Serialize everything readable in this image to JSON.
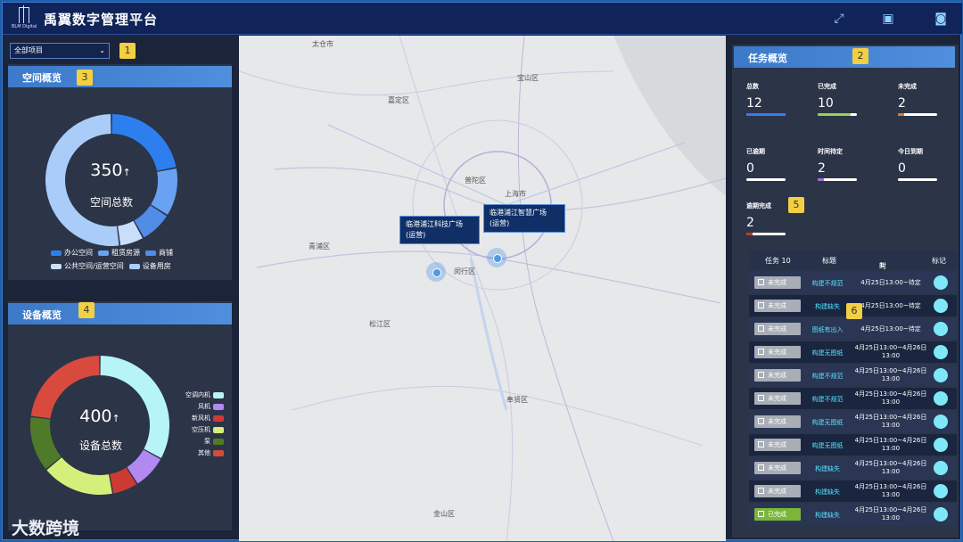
{
  "header": {
    "title": "禹翼数字管理平台",
    "brand": "BLM Digital"
  },
  "project_select": {
    "value": "全部项目"
  },
  "badges": [
    "1",
    "2",
    "3",
    "4",
    "5",
    "6"
  ],
  "space": {
    "title": "空间概览",
    "total": "350",
    "arrow": "↑",
    "total_label": "空间总数",
    "legend": [
      {
        "label": "办公空间",
        "color": "#2d7ff0"
      },
      {
        "label": "租赁房源",
        "color": "#6aa2f3"
      },
      {
        "label": "商铺",
        "color": "#4f8de6"
      },
      {
        "label": "公共空间/运营空间",
        "color": "#c8defa"
      },
      {
        "label": "设备用房",
        "color": "#a9cdf8"
      }
    ]
  },
  "device": {
    "title": "设备概览",
    "total": "400",
    "arrow": "↑",
    "total_label": "设备总数",
    "legend": [
      {
        "label": "空调内机",
        "color": "#b6f4f8"
      },
      {
        "label": "风机",
        "color": "#b189f0"
      },
      {
        "label": "新风机",
        "color": "#cc3a33"
      },
      {
        "label": "空压机",
        "color": "#d4f07a"
      },
      {
        "label": "泵",
        "color": "#4f7a2a"
      },
      {
        "label": "其他",
        "color": "#d84a3e"
      }
    ]
  },
  "map": {
    "labels": [
      "太仓市",
      "嘉定区",
      "宝山区",
      "青浦区",
      "闵行区",
      "松江区",
      "奉贤区",
      "金山区",
      "上海市",
      "普陀区"
    ],
    "callouts": [
      {
        "line1": "临港浦江科技广场",
        "line2": "(运营)"
      },
      {
        "line1": "临港浦江智慧广场",
        "line2": "(运营)"
      }
    ]
  },
  "task": {
    "title": "任务概览",
    "stats": [
      {
        "label": "总数",
        "value": "12",
        "fill": 1.0,
        "color": "#2d7ff0"
      },
      {
        "label": "已完成",
        "value": "10",
        "fill": 0.83,
        "color": "#9bd14b"
      },
      {
        "label": "未完成",
        "value": "2",
        "fill": 0.17,
        "color": "#e07a2a"
      },
      {
        "label": "已逾期",
        "value": "0",
        "fill": 0,
        "color": "#2d7ff0"
      },
      {
        "label": "时间待定",
        "value": "2",
        "fill": 0.17,
        "color": "#a36be0"
      },
      {
        "label": "今日到期",
        "value": "0",
        "fill": 0,
        "color": "#2d7ff0"
      },
      {
        "label": "逾期完成",
        "value": "2",
        "fill": 0.17,
        "color": "#c0392b"
      }
    ],
    "table": {
      "col_task": "任务 10",
      "col_title": "标题",
      "col_time": "时间",
      "sort_icon": "⇅",
      "col_mark": "标记",
      "rows": [
        {
          "status": "未完成",
          "done": false,
          "title": "构建不规范",
          "time": "4月25日13:00~待定"
        },
        {
          "status": "未完成",
          "done": false,
          "title": "构建缺失",
          "time": "4月25日13:00~待定"
        },
        {
          "status": "未完成",
          "done": false,
          "title": "图纸有出入",
          "time": "4月25日13:00~待定"
        },
        {
          "status": "未完成",
          "done": false,
          "title": "构建无图纸",
          "time": "4月25日13:00~4月26日 13:00"
        },
        {
          "status": "未完成",
          "done": false,
          "title": "构建不规范",
          "time": "4月25日13:00~4月26日 13:00"
        },
        {
          "status": "未完成",
          "done": false,
          "title": "构建不规范",
          "time": "4月25日13:00~4月26日 13:00"
        },
        {
          "status": "未完成",
          "done": false,
          "title": "构建无图纸",
          "time": "4月25日13:00~4月26日 13:00"
        },
        {
          "status": "未完成",
          "done": false,
          "title": "构建无图纸",
          "time": "4月25日13:00~4月26日 13:00"
        },
        {
          "status": "未完成",
          "done": false,
          "title": "构建缺失",
          "time": "4月25日13:00~4月26日 13:00"
        },
        {
          "status": "未完成",
          "done": false,
          "title": "构建缺失",
          "time": "4月25日13:00~4月26日 13:00"
        },
        {
          "status": "已完成",
          "done": true,
          "title": "构建缺失",
          "time": "4月25日13:00~4月26日 13:00"
        }
      ]
    }
  },
  "watermark": "大数跨境"
}
